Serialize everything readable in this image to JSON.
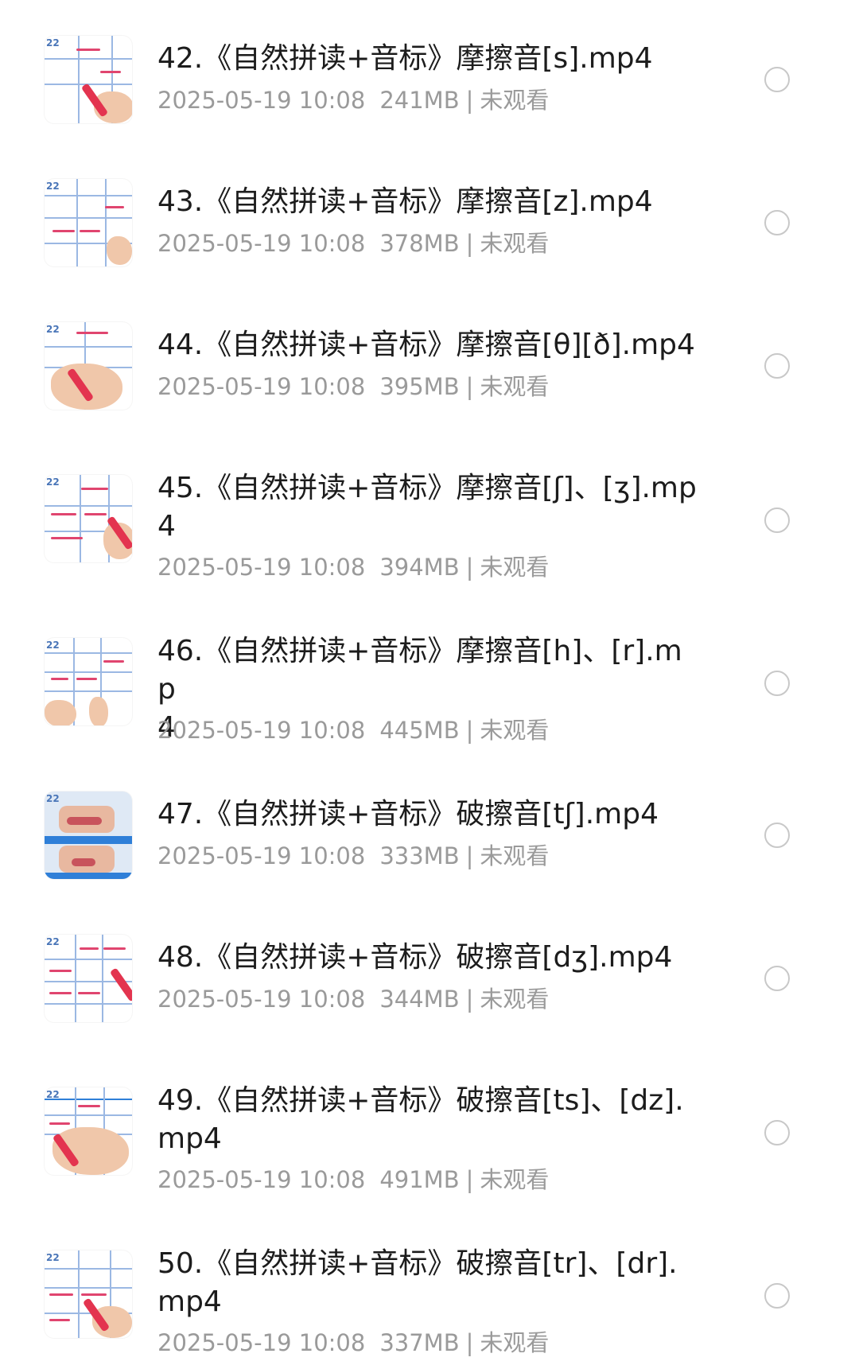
{
  "files": [
    {
      "name": "42.《自然拼读+音标》摩擦音[s].mp4",
      "date": "2025-05-19 10:08",
      "size": "241MB",
      "separator": "|",
      "status": "未观看",
      "selected": false
    },
    {
      "name": "43.《自然拼读+音标》摩擦音[z].mp4",
      "date": "2025-05-19 10:08",
      "size": "378MB",
      "separator": "|",
      "status": "未观看",
      "selected": false
    },
    {
      "name": "44.《自然拼读+音标》摩擦音[θ][ð].mp4",
      "date": "2025-05-19 10:08",
      "size": "395MB",
      "separator": "|",
      "status": "未观看",
      "selected": false
    },
    {
      "name_line1": "45.《自然拼读+音标》摩擦音[ʃ]、[ʒ].mp",
      "name_line2": "4",
      "date": "2025-05-19 10:08",
      "size": "394MB",
      "separator": "|",
      "status": "未观看",
      "selected": false
    },
    {
      "name_line1": "46.《自然拼读+音标》摩擦音[h]、[r].mp",
      "name_line2": "4",
      "date": "2025-05-19 10:08",
      "size": "445MB",
      "separator": "|",
      "status": "未观看",
      "selected": false
    },
    {
      "name": "47.《自然拼读+音标》破擦音[tʃ].mp4",
      "date": "2025-05-19 10:08",
      "size": "333MB",
      "separator": "|",
      "status": "未观看",
      "selected": false
    },
    {
      "name": "48.《自然拼读+音标》破擦音[dʒ].mp4",
      "date": "2025-05-19 10:08",
      "size": "344MB",
      "separator": "|",
      "status": "未观看",
      "selected": false
    },
    {
      "name_line1": "49.《自然拼读+音标》破擦音[ts]、[dz].",
      "name_line2": "mp4",
      "date": "2025-05-19 10:08",
      "size": "491MB",
      "separator": "|",
      "status": "未观看",
      "selected": false
    },
    {
      "name_line1": "50.《自然拼读+音标》破擦音[tr]、[dr].",
      "name_line2": "mp4",
      "date": "2025-05-19 10:08",
      "size": "337MB",
      "separator": "|",
      "status": "未观看",
      "selected": false
    }
  ],
  "thumbnail_tag": "22",
  "icons": {
    "thumbnail": "video-thumbnail-icon",
    "select": "radio-circle-icon"
  },
  "colors": {
    "title": "#1c1c1c",
    "meta": "#9a9a9a",
    "radio_border": "#c8c8c8",
    "background": "#ffffff"
  }
}
